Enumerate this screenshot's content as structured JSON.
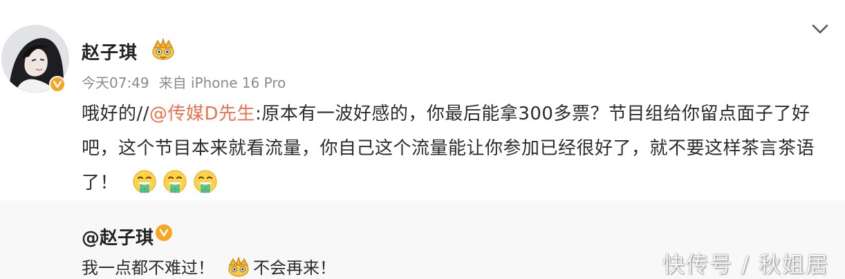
{
  "post": {
    "author": "赵子琪",
    "time": "今天07:49",
    "source": "来自 iPhone 16 Pro",
    "text_prefix": "哦好的//",
    "mention": "@传媒D先生",
    "text_body": ":原本有一波好感的，你最后能拿300多票？节目组给你留点面子了好吧，这个节目本来就看流量，你自己这个流量能让你参加已经很好了，就不要这样茶言茶语了！",
    "emoji_icons": [
      "vomit-emoji-icon",
      "vomit-emoji-icon",
      "vomit-emoji-icon"
    ],
    "author_badge_icon": "crown-icon",
    "menu_icon": "chevron-down-icon"
  },
  "retweet": {
    "author": "@赵子琪",
    "text_before_icon": "我一点都不难过！",
    "inline_icon": "crown-icon",
    "text_after_icon": "不会再来！"
  },
  "watermark": {
    "text": "快传号 / 秋姐居"
  },
  "colors": {
    "mention": "#eb7350",
    "verified": "#f5a623",
    "meta_gray": "#8a8a8a",
    "retweet_bg": "#f8f8f8"
  }
}
